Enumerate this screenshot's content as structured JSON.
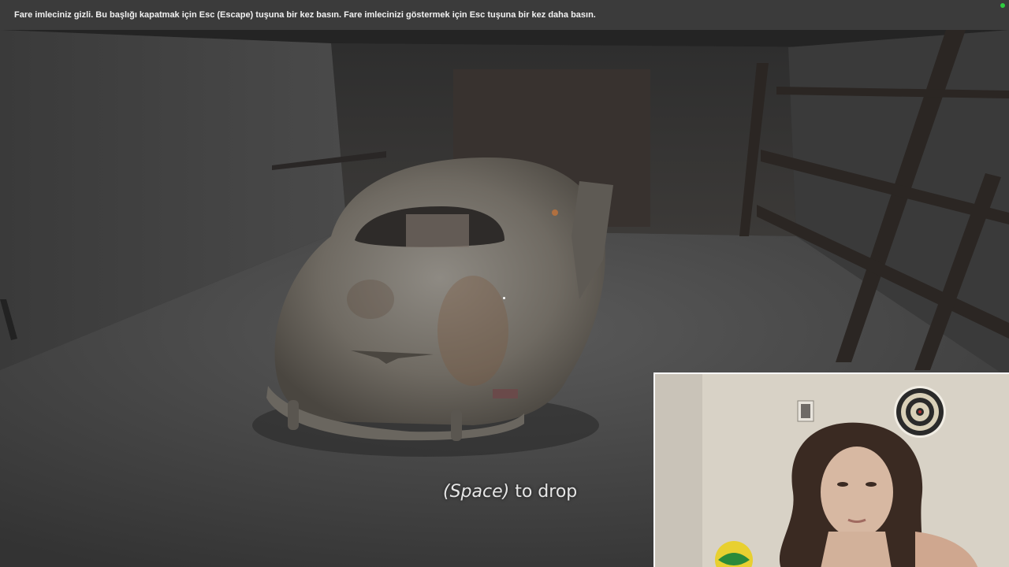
{
  "fullscreen_notice": {
    "text": "Fare imleciniz gizli. Bu başlığı kapatmak için Esc (Escape) tuşuna bir kez basın. Fare imlecinizi göstermek için Esc tuşuna bir kez daha basın."
  },
  "hud": {
    "prompt_key": "(Space)",
    "prompt_action": " to drop"
  },
  "scene": {
    "location": "garage",
    "objects": [
      "old-car",
      "wooden-shelves",
      "garage-door"
    ]
  },
  "webcam": {
    "objects": [
      "person",
      "dartboard",
      "portrait-frame",
      "soccer-ball"
    ]
  },
  "colors": {
    "banner_bg": "#3b3b3b",
    "banner_text": "#f2f2f2",
    "indicator": "#2ecc40",
    "prompt_text": "#e6e6e6"
  }
}
